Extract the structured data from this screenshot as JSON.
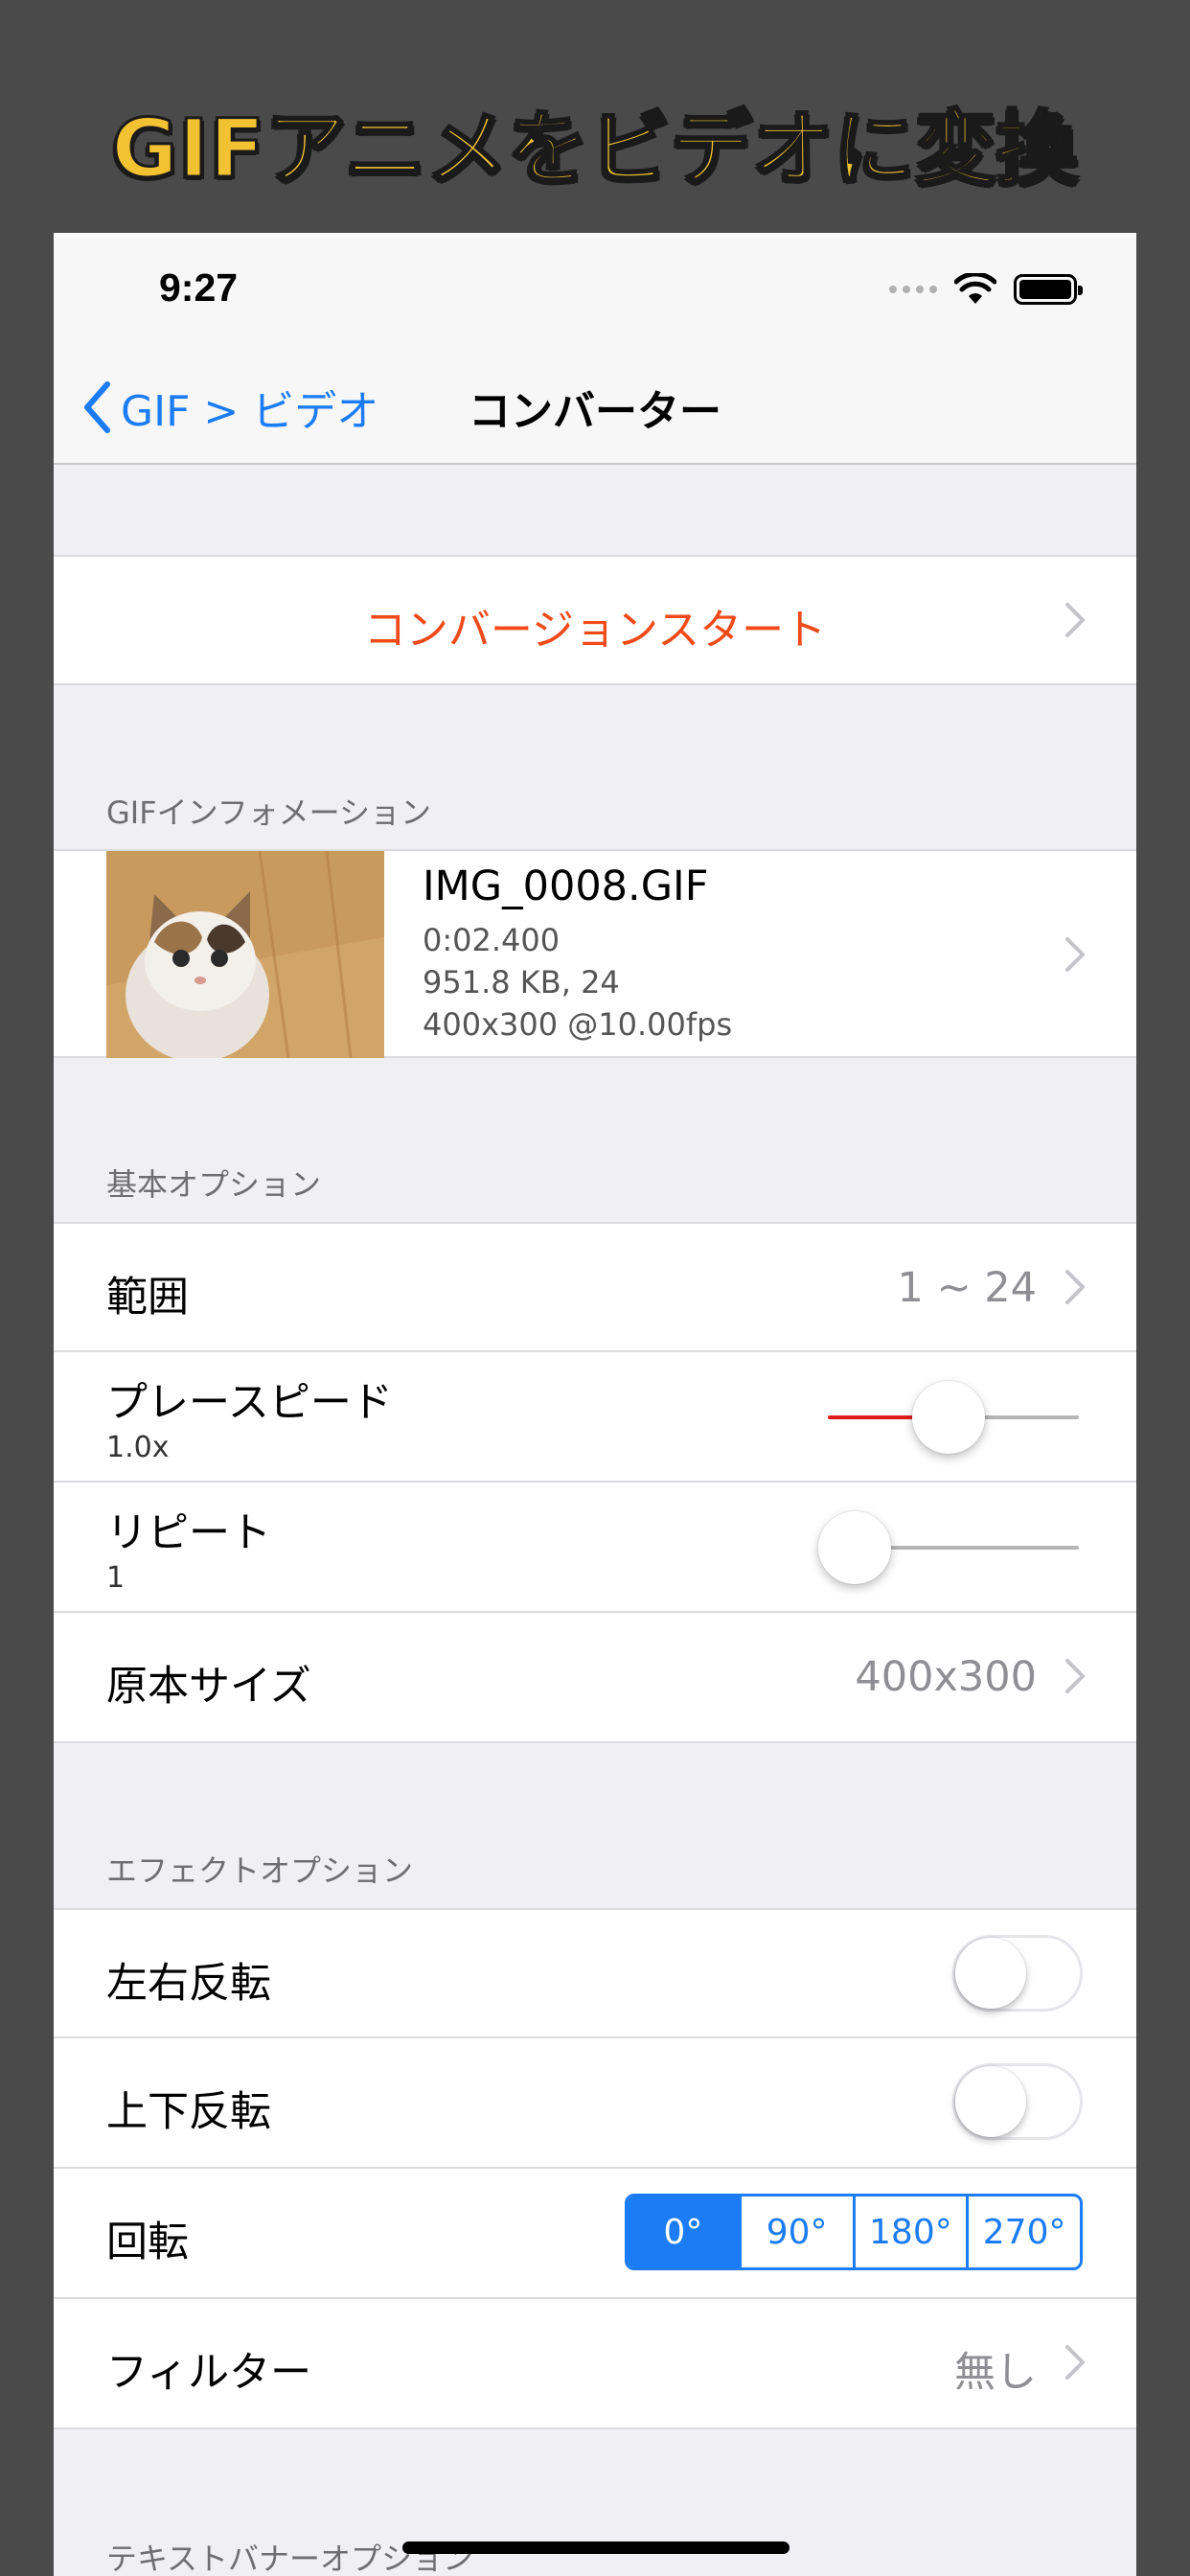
{
  "banner": {
    "title": "GIFアニメをビデオに変換"
  },
  "status_bar": {
    "time": "9:27"
  },
  "navbar": {
    "back_label": "GIF > ビデオ",
    "title": "コンバーター"
  },
  "start_button": {
    "label": "コンバージョンスタート"
  },
  "gif_info": {
    "header": "GIFインフォメーション",
    "filename": "IMG_0008.GIF",
    "duration": "0:02.400",
    "size_frames": "951.8 KB, 24",
    "resolution_fps": "400x300 @10.00fps"
  },
  "basic_options": {
    "header": "基本オプション",
    "range": {
      "label": "範囲",
      "value": "1 ~ 24"
    },
    "play_speed": {
      "label": "プレースピード",
      "value": "1.0x",
      "slider_fraction": 0.48
    },
    "repeat": {
      "label": "リピート",
      "value": "1",
      "slider_fraction": 0.0
    },
    "original_size": {
      "label": "原本サイズ",
      "value": "400x300"
    }
  },
  "effect_options": {
    "header": "エフェクトオプション",
    "flip_horizontal": {
      "label": "左右反転",
      "on": false
    },
    "flip_vertical": {
      "label": "上下反転",
      "on": false
    },
    "rotation": {
      "label": "回転",
      "options": [
        "0°",
        "90°",
        "180°",
        "270°"
      ],
      "selected": "0°"
    },
    "filter": {
      "label": "フィルター",
      "value": "無し"
    }
  },
  "text_banner_options": {
    "header": "テキストバナーオプション"
  },
  "colors": {
    "accent": "#1b7cf5",
    "start_text": "#f04a1a",
    "slider_fill": "#e01d1d",
    "headline": "#f2c233",
    "outer_bg": "#4a4a4a",
    "group_bg": "#efeff4"
  }
}
